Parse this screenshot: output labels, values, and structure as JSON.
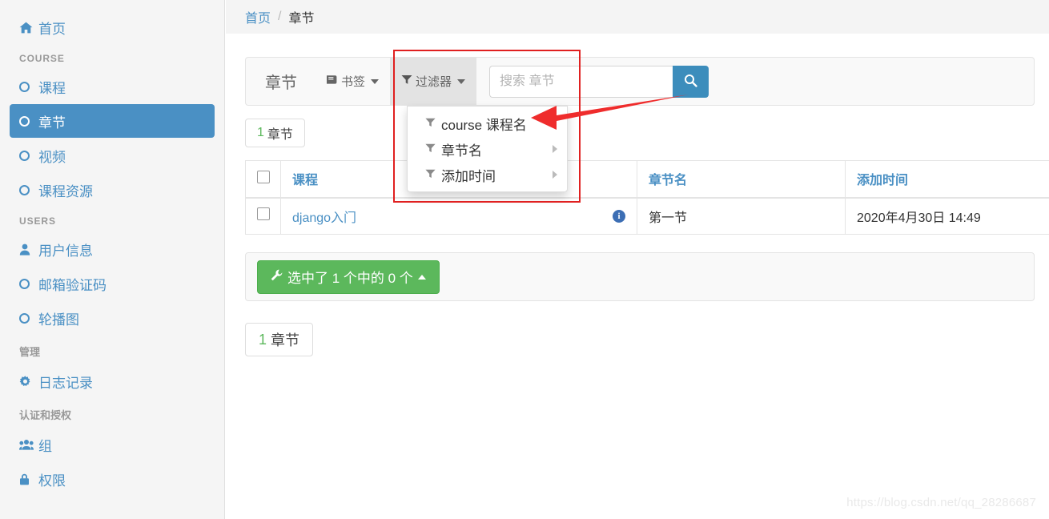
{
  "sidebar": {
    "home": {
      "label": "首页",
      "icon": "home-icon"
    },
    "groups": [
      {
        "heading": "COURSE",
        "heading_kind": "latin",
        "items": [
          {
            "label": "课程",
            "icon": "circle-icon",
            "active": false
          },
          {
            "label": "章节",
            "icon": "circle-icon",
            "active": true
          },
          {
            "label": "视频",
            "icon": "circle-icon",
            "active": false
          },
          {
            "label": "课程资源",
            "icon": "circle-icon",
            "active": false
          }
        ]
      },
      {
        "heading": "USERS",
        "heading_kind": "latin",
        "items": [
          {
            "label": "用户信息",
            "icon": "user-icon",
            "active": false
          },
          {
            "label": "邮箱验证码",
            "icon": "circle-icon",
            "active": false
          },
          {
            "label": "轮播图",
            "icon": "circle-icon",
            "active": false
          }
        ]
      },
      {
        "heading": "管理",
        "heading_kind": "cjk",
        "items": [
          {
            "label": "日志记录",
            "icon": "gear-icon",
            "active": false
          }
        ]
      },
      {
        "heading": "认证和授权",
        "heading_kind": "cjk",
        "items": [
          {
            "label": "组",
            "icon": "users-group-icon",
            "active": false
          },
          {
            "label": "权限",
            "icon": "lock-icon",
            "active": false
          }
        ]
      }
    ]
  },
  "breadcrumb": {
    "home": "首页",
    "separator": "/",
    "current": "章节"
  },
  "toolbar": {
    "title": "章节",
    "bookmark_label": "书签",
    "bookmark_icon": "bookmark-icon",
    "filter_label": "过滤器",
    "filter_icon": "filter-icon",
    "search_placeholder": "搜索 章节",
    "search_value": "",
    "search_button_icon": "search-icon"
  },
  "filter_menu": {
    "items": [
      {
        "label": "course 课程名",
        "icon": "filter-icon",
        "has_submenu": false
      },
      {
        "label": "章节名",
        "icon": "filter-icon",
        "has_submenu": true
      },
      {
        "label": "添加时间",
        "icon": "filter-icon",
        "has_submenu": true
      }
    ]
  },
  "top_count_badge": {
    "number": "1",
    "label": "章节"
  },
  "table": {
    "select_all_checkbox": "",
    "columns": [
      "课程",
      "章节名",
      "添加时间"
    ],
    "rows": [
      {
        "checked": false,
        "course": "django入门",
        "info_icon": "info-icon",
        "chapter": "第一节",
        "added_time": "2020年4月30日 14:49"
      }
    ]
  },
  "action_bar": {
    "button_label": "选中了 1 个中的 0 个",
    "button_icon": "wrench-icon",
    "caret": "caret-up-icon"
  },
  "bottom_pager": {
    "number": "1",
    "label": "章节"
  },
  "watermark": "https://blog.csdn.net/qq_28286687",
  "colors": {
    "accent_blue": "#4a90c4",
    "button_blue": "#3c8dbc",
    "success_green": "#5cb85c",
    "annotation_red": "#e02020",
    "sidebar_bg": "#f5f5f5",
    "panel_bg": "#f9f9f9"
  }
}
